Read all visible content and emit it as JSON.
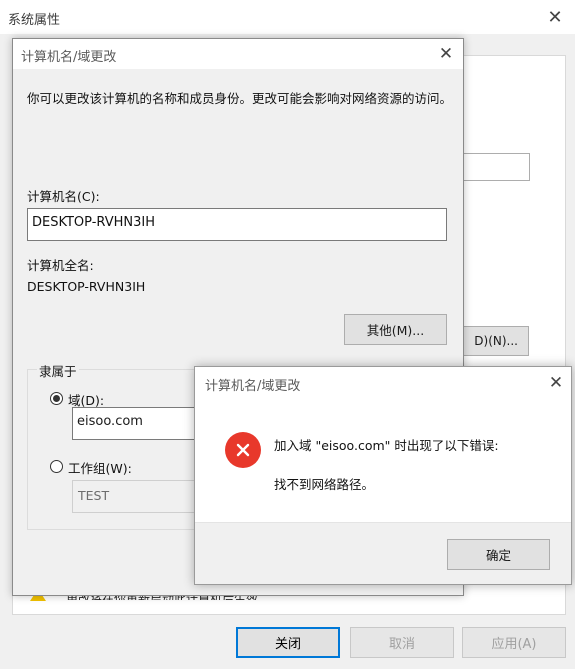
{
  "system_properties": {
    "title": "系统属性",
    "close_glyph": "✕",
    "change_button_label": "D)(N)...",
    "warning_text": "更改将在你重新启动此计算机后生效。",
    "buttons": {
      "ok": "关闭",
      "cancel": "取消",
      "apply": "应用(A)"
    }
  },
  "computer_name_dialog": {
    "title": "计算机名/域更改",
    "close_glyph": "✕",
    "description": "你可以更改该计算机的名称和成员身份。更改可能会影响对网络资源的访问。",
    "computer_name_label": "计算机名(C):",
    "computer_name_value": "DESKTOP-RVHN3IH",
    "full_name_label": "计算机全名:",
    "full_name_value": "DESKTOP-RVHN3IH",
    "more_button": "其他(M)...",
    "member_of_label": "隶属于",
    "domain_label": "域(D):",
    "domain_value": "eisoo.com",
    "workgroup_label": "工作组(W):",
    "workgroup_value": "TEST"
  },
  "error_dialog": {
    "title": "计算机名/域更改",
    "close_glyph": "✕",
    "message_line1": "加入域 \"eisoo.com\" 时出现了以下错误:",
    "message_line2": "找不到网络路径。",
    "confirm_button": "确定"
  }
}
